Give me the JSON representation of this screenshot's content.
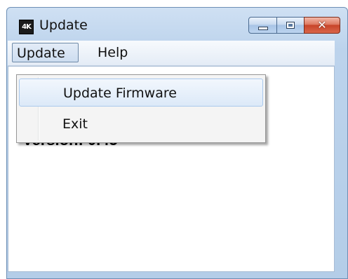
{
  "window": {
    "title": "Update",
    "icon_label": "4K",
    "icon_name": "app-logo-icon"
  },
  "caption_buttons": {
    "minimize_icon": "minimize-icon",
    "maximize_icon": "maximize-icon",
    "close_icon": "close-icon",
    "close_glyph": "✕"
  },
  "menubar": {
    "items": [
      {
        "label": "Update"
      },
      {
        "label": "Help"
      }
    ]
  },
  "dropdown": {
    "items": [
      {
        "label": "Update Firmware"
      },
      {
        "label": "Exit"
      }
    ]
  },
  "client": {
    "version_text": "Version: 0.45"
  },
  "colors": {
    "titlebar": "#bcd3ec",
    "close_button": "#c8452a",
    "menu_highlight": "#dce9f8"
  }
}
